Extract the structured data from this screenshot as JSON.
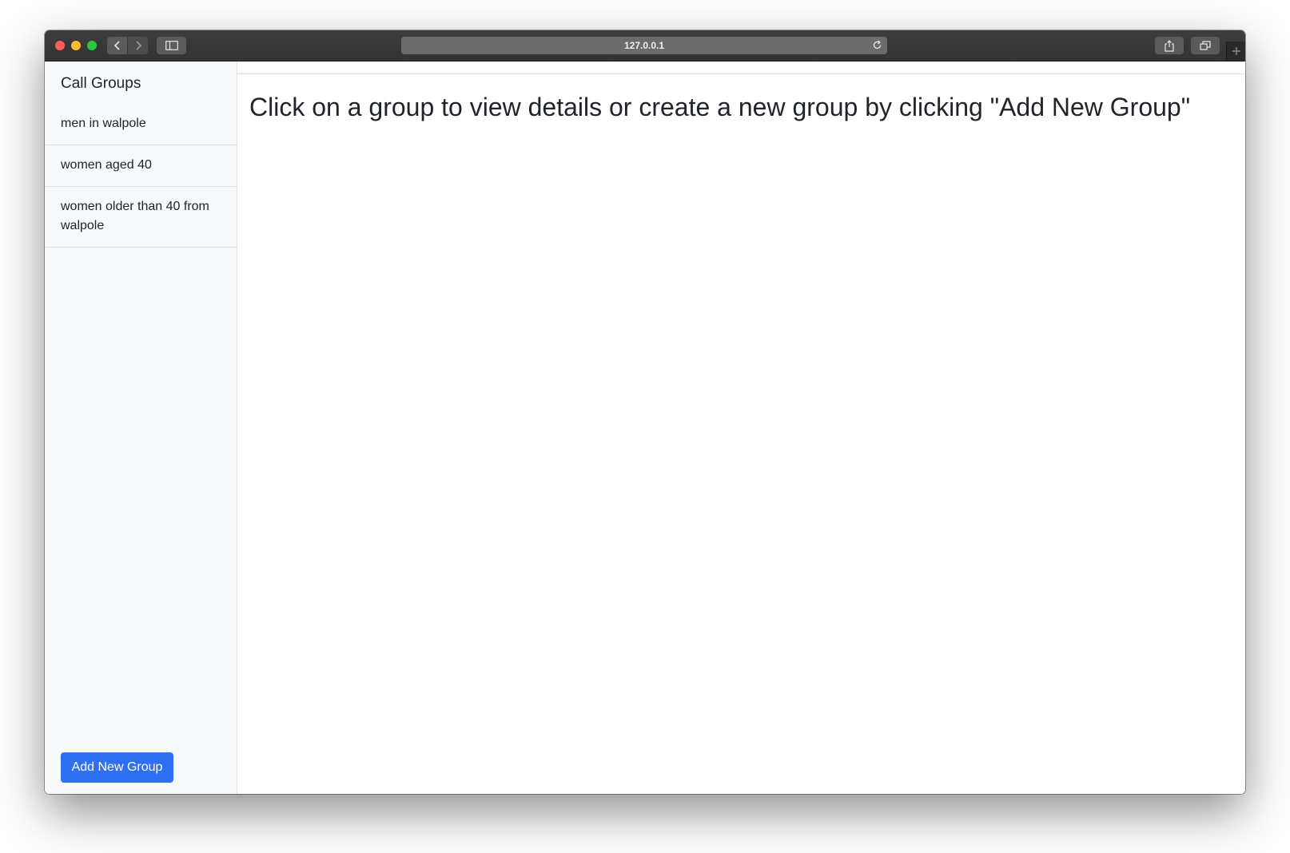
{
  "browser": {
    "url": "127.0.0.1"
  },
  "sidebar": {
    "title": "Call Groups",
    "groups": [
      {
        "label": "men in walpole"
      },
      {
        "label": "women aged 40"
      },
      {
        "label": "women older than 40 from walpole"
      }
    ],
    "add_button_label": "Add New Group"
  },
  "main": {
    "heading": "Click on a group to view details or create a new group by clicking \"Add New Group\""
  },
  "colors": {
    "accent": "#2f6ff2",
    "sidebar_bg": "#f8f9fa",
    "titlebar_bg": "#3a3a3a"
  },
  "icons": [
    "back-chevron-icon",
    "forward-chevron-icon",
    "sidebar-icon",
    "reload-icon",
    "share-icon",
    "tabs-icon",
    "plus-icon"
  ]
}
